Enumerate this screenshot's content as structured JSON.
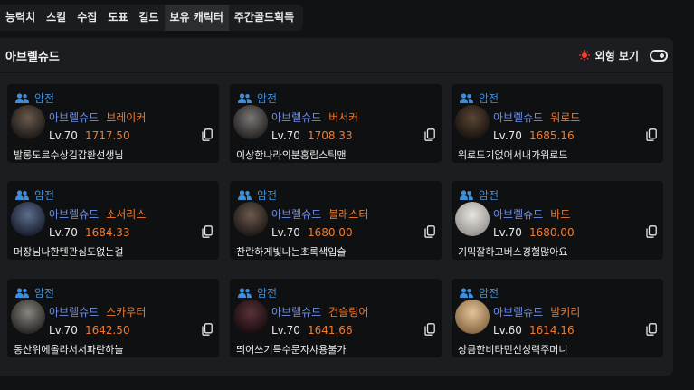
{
  "tabs": [
    {
      "label": "능력치",
      "active": false
    },
    {
      "label": "스킬",
      "active": false
    },
    {
      "label": "수집",
      "active": false
    },
    {
      "label": "도표",
      "active": false
    },
    {
      "label": "길드",
      "active": false
    },
    {
      "label": "보유 캐릭터",
      "active": true
    },
    {
      "label": "주간골드획득",
      "active": false
    }
  ],
  "panel": {
    "title": "아브렐슈드",
    "view_label": "외형 보기",
    "accent_color": "#ff3b30"
  },
  "characters": [
    {
      "class": "암전",
      "server": "아브렐슈드",
      "job": "브레이커",
      "level": "Lv.70",
      "item_level": "1717.50",
      "name": "발롱도르수상김갑환선생님"
    },
    {
      "class": "암전",
      "server": "아브렐슈드",
      "job": "버서커",
      "level": "Lv.70",
      "item_level": "1708.33",
      "name": "이상한나라의분홍립스틱맨"
    },
    {
      "class": "암전",
      "server": "아브렐슈드",
      "job": "워로드",
      "level": "Lv.70",
      "item_level": "1685.16",
      "name": "워로드기없어서내가워로드"
    },
    {
      "class": "암전",
      "server": "아브렐슈드",
      "job": "소서리스",
      "level": "Lv.70",
      "item_level": "1684.33",
      "name": "머장님나한텐관심도없는걸"
    },
    {
      "class": "암전",
      "server": "아브렐슈드",
      "job": "블래스터",
      "level": "Lv.70",
      "item_level": "1680.00",
      "name": "찬란하게빛나는초록색입술"
    },
    {
      "class": "암전",
      "server": "아브렐슈드",
      "job": "바드",
      "level": "Lv.70",
      "item_level": "1680.00",
      "name": "기믹잘하고버스경험많아요"
    },
    {
      "class": "암전",
      "server": "아브렐슈드",
      "job": "스카우터",
      "level": "Lv.70",
      "item_level": "1642.50",
      "name": "동산위에올라서서파란하늘"
    },
    {
      "class": "암전",
      "server": "아브렐슈드",
      "job": "건슬링어",
      "level": "Lv.70",
      "item_level": "1641.66",
      "name": "띄어쓰기특수문자사용불가"
    },
    {
      "class": "암전",
      "server": "아브렐슈드",
      "job": "발키리",
      "level": "Lv.60",
      "item_level": "1614.16",
      "name": "상큼한비타민신성력주머니"
    }
  ],
  "colors": {
    "class": "#3d8fdc",
    "server": "#6f8ee8",
    "job": "#f07b30",
    "item_level": "#f07b30"
  },
  "icons": {
    "class_icon": "people-icon",
    "copy_icon": "copy-icon",
    "view_icon": "sun-icon",
    "toggle": "toggle-switch"
  }
}
